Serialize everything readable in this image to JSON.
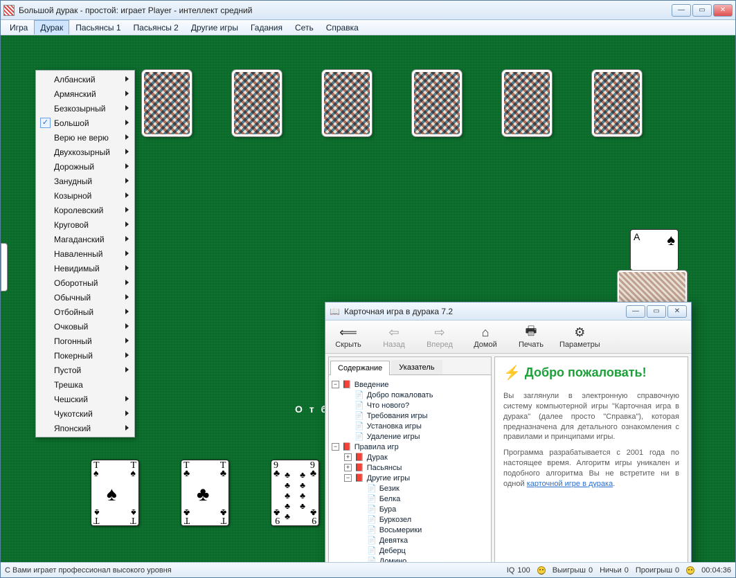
{
  "window": {
    "title": "Большой дурак - простой: играет Player - интеллект средний"
  },
  "menubar": [
    "Игра",
    "Дурак",
    "Пасьянсы 1",
    "Пасьянсы 2",
    "Другие игры",
    "Гадания",
    "Сеть",
    "Справка"
  ],
  "menubar_open_index": 1,
  "dropdown": {
    "items": [
      {
        "label": "Албанский",
        "sub": true
      },
      {
        "label": "Армянский",
        "sub": true
      },
      {
        "label": "Безкозырный",
        "sub": true
      },
      {
        "label": "Большой",
        "sub": true,
        "checked": true
      },
      {
        "label": "Верю не верю",
        "sub": true
      },
      {
        "label": "Двухкозырный",
        "sub": true
      },
      {
        "label": "Дорожный",
        "sub": true
      },
      {
        "label": "Занудный",
        "sub": true
      },
      {
        "label": "Козырной",
        "sub": true
      },
      {
        "label": "Королевский",
        "sub": true
      },
      {
        "label": "Круговой",
        "sub": true
      },
      {
        "label": "Магаданский",
        "sub": true
      },
      {
        "label": "Наваленный",
        "sub": true
      },
      {
        "label": "Невидимый",
        "sub": true
      },
      {
        "label": "Оборотный",
        "sub": true
      },
      {
        "label": "Обычный",
        "sub": true
      },
      {
        "label": "Отбойный",
        "sub": true
      },
      {
        "label": "Очковый",
        "sub": true
      },
      {
        "label": "Погонный",
        "sub": true
      },
      {
        "label": "Покерный",
        "sub": true
      },
      {
        "label": "Пустой",
        "sub": true
      },
      {
        "label": "Трешка",
        "sub": false
      },
      {
        "label": "Чешский",
        "sub": true
      },
      {
        "label": "Чукотский",
        "sub": true
      },
      {
        "label": "Японский",
        "sub": true
      }
    ]
  },
  "mid_label": "О т б",
  "deck_top": {
    "rank": "A",
    "suit": "♠"
  },
  "player_cards": [
    {
      "rank": "Т",
      "suit": "♠"
    },
    {
      "rank": "Т",
      "suit": "♣"
    },
    {
      "rank": "9",
      "suit": "♣",
      "pips": 9
    }
  ],
  "statusbar": {
    "left": "С Вами играет профессионал высокого уровня",
    "iq_label": "IQ",
    "iq_value": "100",
    "wins_label": "Выигрыш",
    "wins_value": "0",
    "draws_label": "Ничьи",
    "draws_value": "0",
    "loss_label": "Проигрыш",
    "loss_value": "0",
    "time": "00:04:36"
  },
  "help": {
    "title": "Карточная игра в дурака 7.2",
    "toolbar": [
      {
        "label": "Скрыть",
        "icon": "⟸",
        "enabled": true
      },
      {
        "label": "Назад",
        "icon": "⇦",
        "enabled": false
      },
      {
        "label": "Вперед",
        "icon": "⇨",
        "enabled": false
      },
      {
        "label": "Домой",
        "icon": "⌂",
        "enabled": true
      },
      {
        "label": "Печать",
        "icon": "🖶",
        "enabled": true
      },
      {
        "label": "Параметры",
        "icon": "⚙",
        "enabled": true
      }
    ],
    "tabs": [
      "Содержание",
      "Указатель"
    ],
    "active_tab": 0,
    "tree": [
      {
        "d": 0,
        "t": "minus",
        "ico": "book",
        "label": "Введение"
      },
      {
        "d": 1,
        "t": "",
        "ico": "page",
        "label": "Добро пожаловать"
      },
      {
        "d": 1,
        "t": "",
        "ico": "page",
        "label": "Что нового?"
      },
      {
        "d": 1,
        "t": "",
        "ico": "page",
        "label": "Требования игры"
      },
      {
        "d": 1,
        "t": "",
        "ico": "page",
        "label": "Установка игры"
      },
      {
        "d": 1,
        "t": "",
        "ico": "page",
        "label": "Удаление игры"
      },
      {
        "d": 0,
        "t": "minus",
        "ico": "book",
        "label": "Правила игр"
      },
      {
        "d": 1,
        "t": "plus",
        "ico": "book",
        "label": "Дурак"
      },
      {
        "d": 1,
        "t": "plus",
        "ico": "book",
        "label": "Пасьянсы"
      },
      {
        "d": 1,
        "t": "minus",
        "ico": "book",
        "label": "Другие игры"
      },
      {
        "d": 2,
        "t": "",
        "ico": "page",
        "label": "Безик"
      },
      {
        "d": 2,
        "t": "",
        "ico": "page",
        "label": "Белка"
      },
      {
        "d": 2,
        "t": "",
        "ico": "page",
        "label": "Бура"
      },
      {
        "d": 2,
        "t": "",
        "ico": "page",
        "label": "Буркозел"
      },
      {
        "d": 2,
        "t": "",
        "ico": "page",
        "label": "Восьмерики"
      },
      {
        "d": 2,
        "t": "",
        "ico": "page",
        "label": "Девятка"
      },
      {
        "d": 2,
        "t": "",
        "ico": "page",
        "label": "Деберц"
      },
      {
        "d": 2,
        "t": "",
        "ico": "page",
        "label": "Домино"
      }
    ],
    "content": {
      "heading": "Добро пожаловать!",
      "p1": "Вы заглянули в электронную справочную систему компьютерной игры \"Карточная игра в дурака\" (далее просто \"Справка\"), которая предназначена для детального ознакомления с правилами и принципами игры.",
      "p2_a": "Программа разрабатывается с 2001 года по настоящее время. Алгоритм игры уникален и подобного алгоритма Вы не встретите ни в одной ",
      "p2_link": "карточной игре в дурака",
      "p2_b": "."
    }
  }
}
